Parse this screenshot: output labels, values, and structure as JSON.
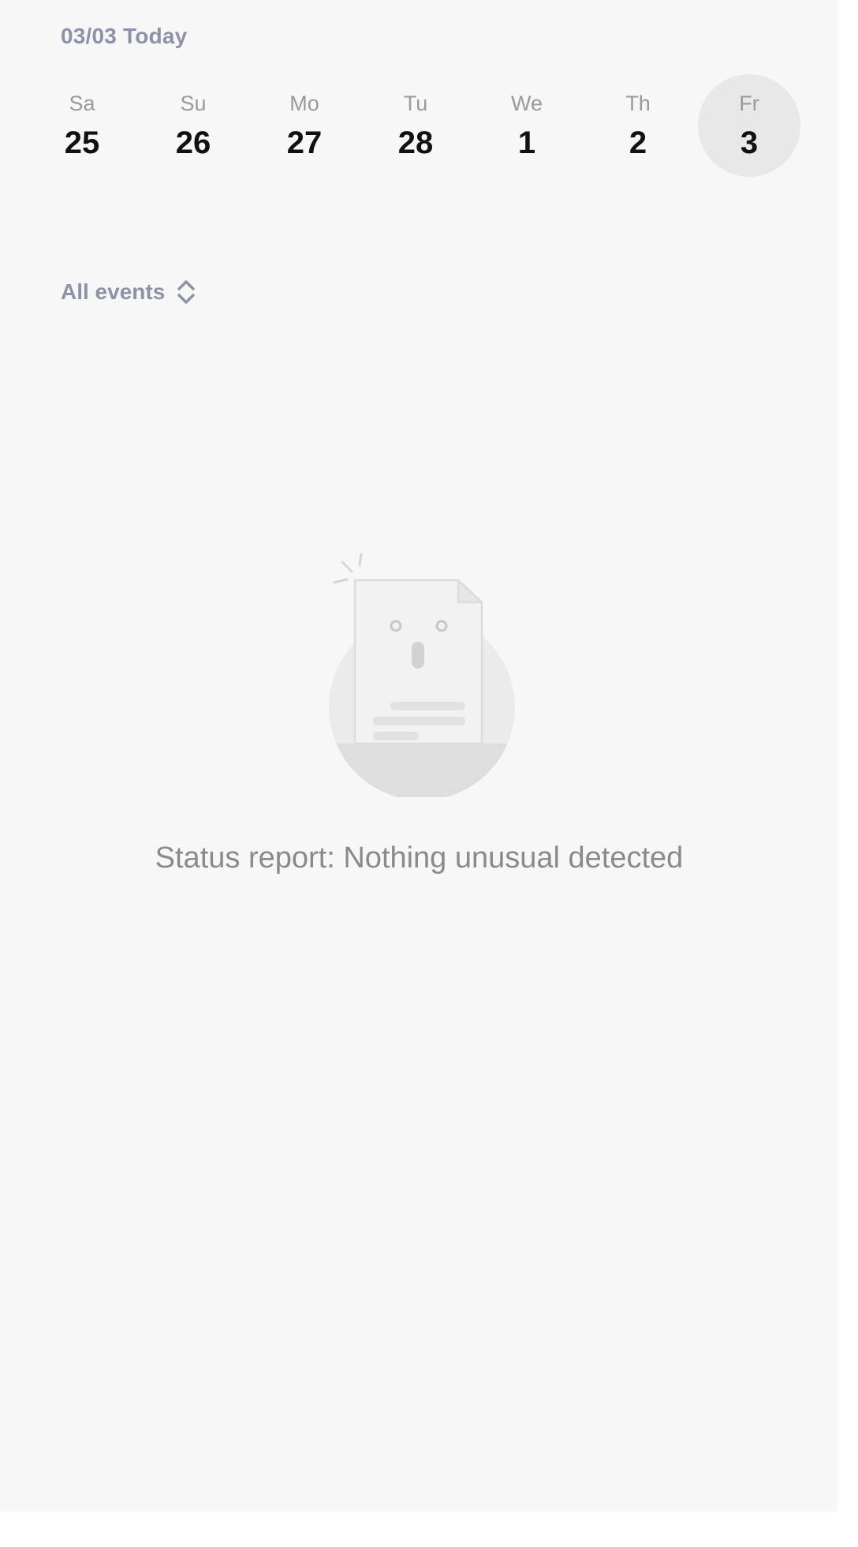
{
  "header": {
    "date_label": "03/03 Today"
  },
  "week": {
    "days": [
      {
        "dow": "Sa",
        "num": "25"
      },
      {
        "dow": "Su",
        "num": "26"
      },
      {
        "dow": "Mo",
        "num": "27"
      },
      {
        "dow": "Tu",
        "num": "28"
      },
      {
        "dow": "We",
        "num": "1"
      },
      {
        "dow": "Th",
        "num": "2"
      },
      {
        "dow": "Fr",
        "num": "3"
      }
    ],
    "selected_index": 6
  },
  "filter": {
    "label": "All events",
    "icon": "chevron-up-down-icon"
  },
  "empty_state": {
    "illustration": "empty-document-icon",
    "message": "Status report: Nothing unusual detected"
  },
  "colors": {
    "background": "#f7f7f7",
    "accent_text": "#8e92a8",
    "selected_day_bg": "#e8e8e8"
  }
}
